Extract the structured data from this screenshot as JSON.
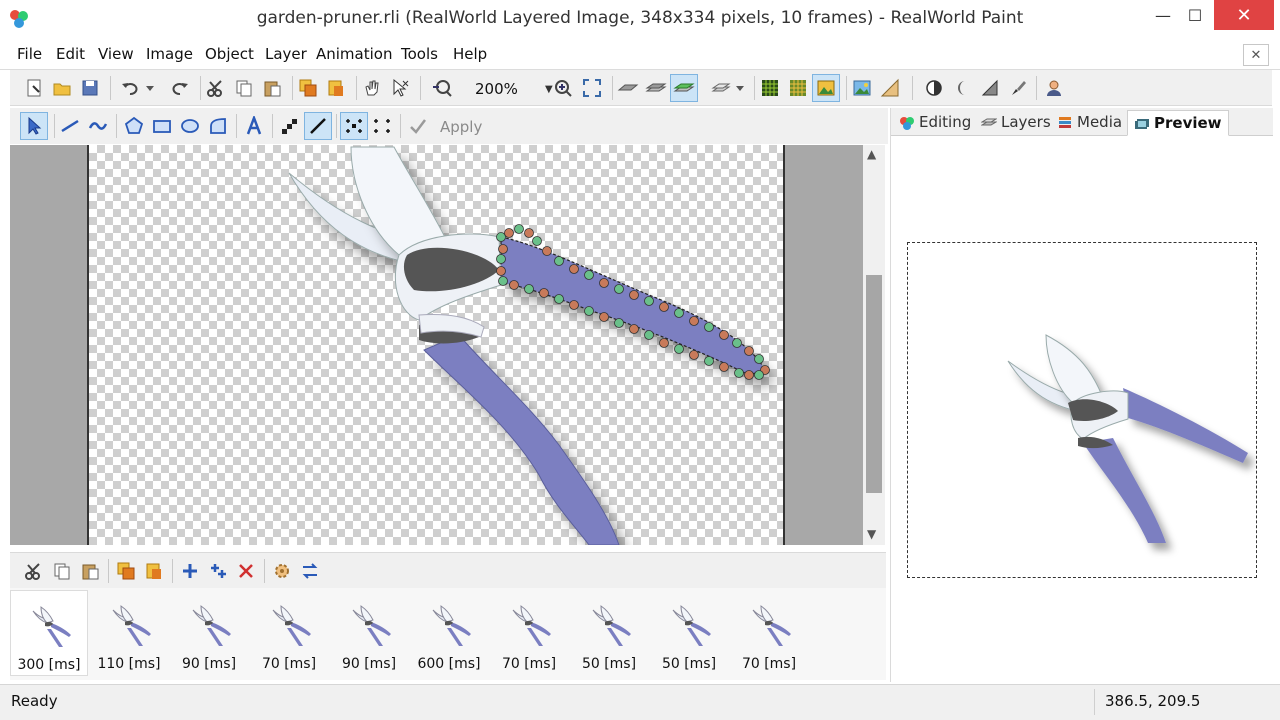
{
  "window": {
    "title": "garden-pruner.rli (RealWorld Layered Image, 348x334 pixels, 10 frames) - RealWorld Paint",
    "minimize": "—",
    "maximize": "☐",
    "close": "✕"
  },
  "menu": {
    "items": [
      "File",
      "Edit",
      "View",
      "Image",
      "Object",
      "Layer",
      "Animation",
      "Tools",
      "Help"
    ],
    "close_doc": "✕"
  },
  "toolbar": {
    "zoom": "200%",
    "apply_label": "Apply"
  },
  "tabs": [
    {
      "label": "Editing",
      "active": false
    },
    {
      "label": "Layers",
      "active": false
    },
    {
      "label": "Media",
      "active": false
    },
    {
      "label": "Preview",
      "active": true
    }
  ],
  "frames": [
    {
      "label": "300 [ms]",
      "selected": true
    },
    {
      "label": "110 [ms]",
      "selected": false
    },
    {
      "label": "90 [ms]",
      "selected": false
    },
    {
      "label": "70 [ms]",
      "selected": false
    },
    {
      "label": "90 [ms]",
      "selected": false
    },
    {
      "label": "600 [ms]",
      "selected": false
    },
    {
      "label": "70 [ms]",
      "selected": false
    },
    {
      "label": "50 [ms]",
      "selected": false
    },
    {
      "label": "50 [ms]",
      "selected": false
    },
    {
      "label": "70 [ms]",
      "selected": false
    }
  ],
  "status": {
    "text": "Ready",
    "coords": "386.5, 209.5"
  },
  "colors": {
    "handle": "#7b7fc1",
    "blade": "#e9eef6",
    "pivot": "#555555",
    "accent": "#cce4f7"
  }
}
